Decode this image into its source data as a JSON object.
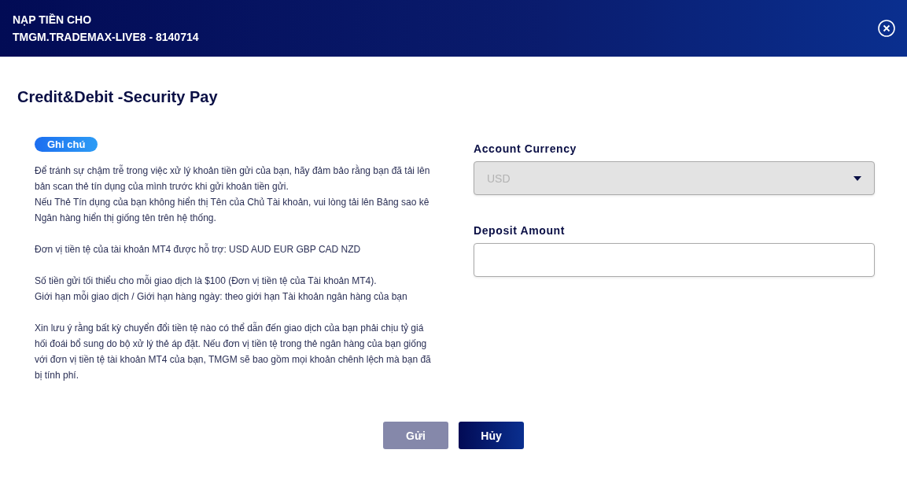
{
  "header": {
    "title_lines": [
      "NẠP TIỀN CHO",
      "TMGM.TRADEMAX-LIVE8 - 8140714"
    ]
  },
  "page_title": "Credit&Debit -Security Pay",
  "note_badge": "Ghi chú",
  "note_groups": [
    [
      "Để tránh sự chậm trễ trong việc xử lý khoản tiền gửi của bạn, hãy đảm bảo rằng bạn đã tải lên bản scan thẻ tín dụng của mình trước khi gửi khoản tiền gửi.",
      "Nếu Thẻ Tín dụng của bạn không hiển thị Tên của Chủ Tài khoản, vui lòng tải lên Bảng sao kê Ngân hàng hiển thị giống tên trên hệ thống."
    ],
    [
      "Đơn vị tiền tệ của tài khoản MT4 được hỗ trợ: USD AUD EUR GBP CAD NZD"
    ],
    [
      "Số tiền gửi tối thiểu cho mỗi giao dịch là $100 (Đơn vị tiền tệ của Tài khoản MT4).",
      "Giới hạn mỗi giao dịch / Giới hạn hàng ngày: theo giới hạn Tài khoản ngân hàng của bạn"
    ],
    [
      "Xin lưu ý rằng bất kỳ chuyển đổi tiền tệ nào có thể dẫn đến giao dịch của bạn phải chịu tỷ giá hối đoái bổ sung do bộ xử lý thẻ áp đặt. Nếu đơn vị tiền tệ trong thẻ ngân hàng của bạn giống với đơn vị tiền tệ tài khoản MT4 của bạn, TMGM sẽ bao gồm mọi khoản chênh lệch mà bạn đã bị tính phí."
    ]
  ],
  "fields": [
    {
      "kind": "select",
      "label": "Account Currency",
      "value": "USD",
      "disabled": true
    },
    {
      "kind": "input",
      "label": "Deposit Amount",
      "disabled": false
    }
  ],
  "buttons": [
    {
      "label": "Gửi",
      "disabled": true
    },
    {
      "label": "Hủy",
      "disabled": false
    }
  ]
}
